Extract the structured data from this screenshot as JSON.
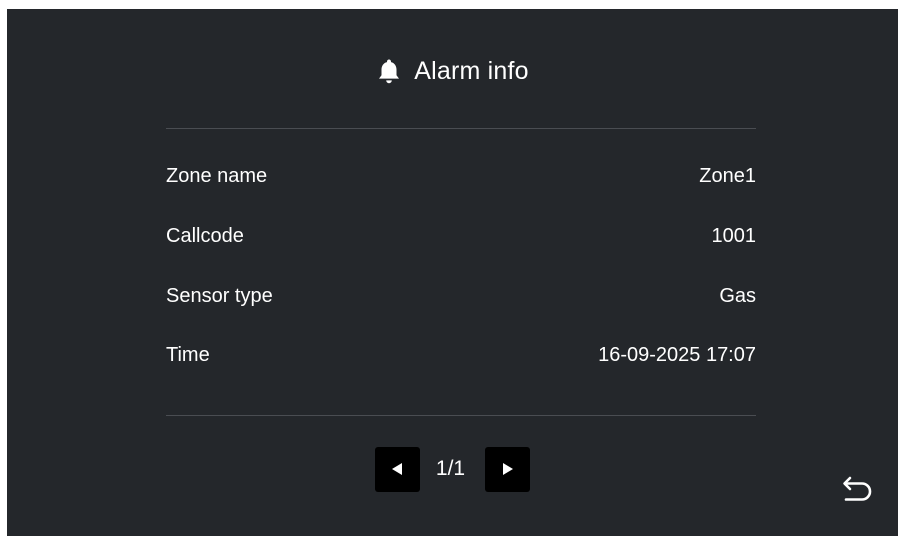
{
  "header": {
    "icon": "bell-icon",
    "title": "Alarm info"
  },
  "details": [
    {
      "label": "Zone name",
      "value": "Zone1"
    },
    {
      "label": "Callcode",
      "value": "1001"
    },
    {
      "label": "Sensor type",
      "value": "Gas"
    },
    {
      "label": "Time",
      "value": "16-09-2025 17:07"
    }
  ],
  "pager": {
    "prev_icon": "triangle-left-icon",
    "next_icon": "triangle-right-icon",
    "page_text": "1/1"
  },
  "back_icon": "back-arrow-icon",
  "colors": {
    "background": "#24272b",
    "text": "#ffffff",
    "divider": "#4a4d52",
    "pager_button": "#000000"
  }
}
